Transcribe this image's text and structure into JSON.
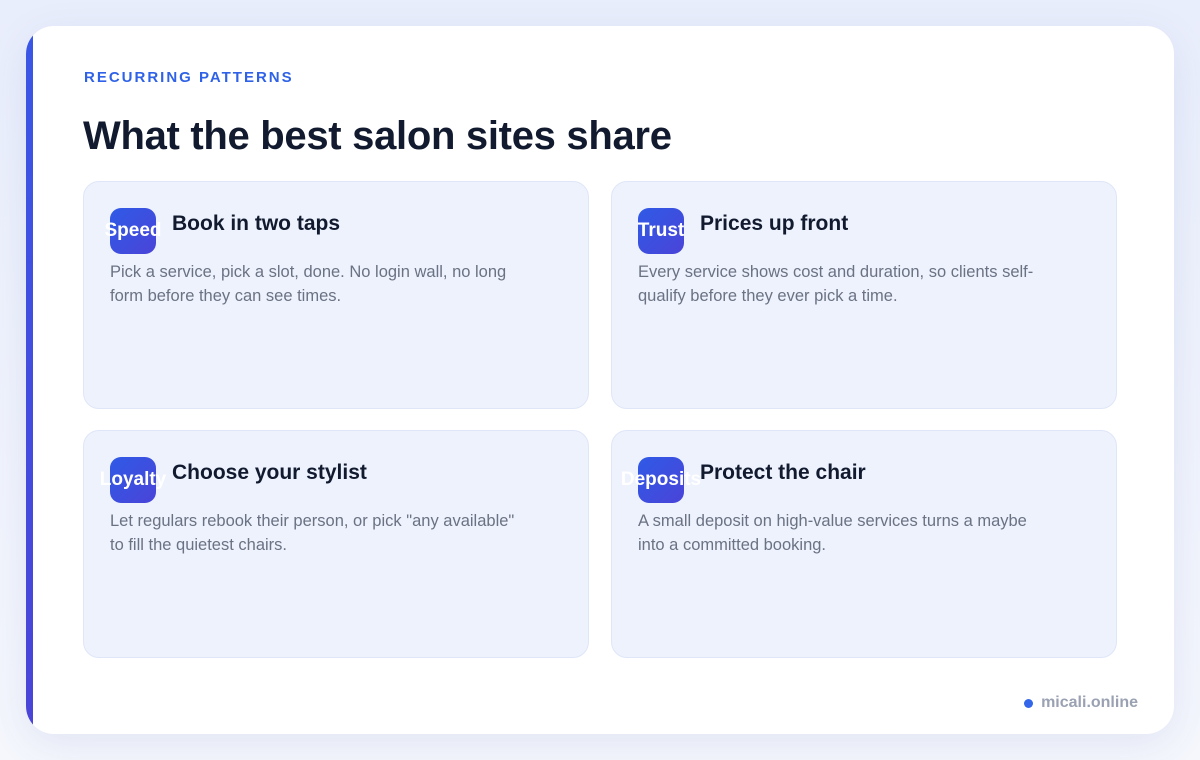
{
  "eyebrow": "RECURRING PATTERNS",
  "title": "What the best salon sites share",
  "colors": {
    "accent": "#2f62e6",
    "card_bg": "#edf2fd",
    "title": "#111a2e",
    "body": "#6b7283"
  },
  "features": [
    {
      "badge": "Speed",
      "title": "Book in two taps",
      "desc": "Pick a service, pick a slot, done. No login wall, no long form before they can see times."
    },
    {
      "badge": "Trust",
      "title": "Prices up front",
      "desc": "Every service shows cost and duration, so clients self-qualify before they ever pick a time."
    },
    {
      "badge": "Loyalty",
      "title": "Choose your stylist",
      "desc": "Let regulars rebook their person, or pick \"any available\" to fill the quietest chairs."
    },
    {
      "badge": "Deposits",
      "title": "Protect the chair",
      "desc": "A small deposit on high-value services turns a maybe into a committed booking."
    }
  ],
  "footer": {
    "site": "micali.online"
  }
}
